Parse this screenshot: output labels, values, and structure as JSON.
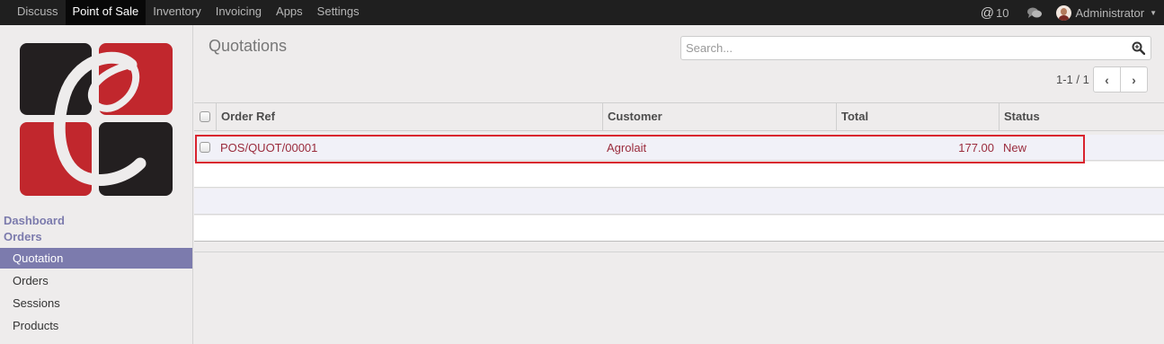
{
  "topbar": {
    "menu": [
      "Discuss",
      "Point of Sale",
      "Inventory",
      "Invoicing",
      "Apps",
      "Settings"
    ],
    "active": "Point of Sale",
    "mentions_count": "10",
    "user_name": "Administrator"
  },
  "sidebar": {
    "sections": [
      "Dashboard",
      "Orders"
    ],
    "items": [
      {
        "label": "Quotation",
        "active": true
      },
      {
        "label": "Orders",
        "active": false
      },
      {
        "label": "Sessions",
        "active": false
      },
      {
        "label": "Products",
        "active": false
      }
    ]
  },
  "main": {
    "title": "Quotations",
    "search_placeholder": "Search...",
    "pager": "1-1 / 1"
  },
  "table": {
    "columns": [
      "Order Ref",
      "Customer",
      "Total",
      "Status"
    ],
    "rows": [
      {
        "order_ref": "POS/QUOT/00001",
        "customer": "Agrolait",
        "total": "177.00",
        "status": "New"
      }
    ]
  },
  "colors": {
    "accent": "#7c7bad",
    "link": "#9a2b3c",
    "highlight": "#d9232e",
    "logo_red": "#c1272d",
    "logo_dark": "#231f20"
  }
}
